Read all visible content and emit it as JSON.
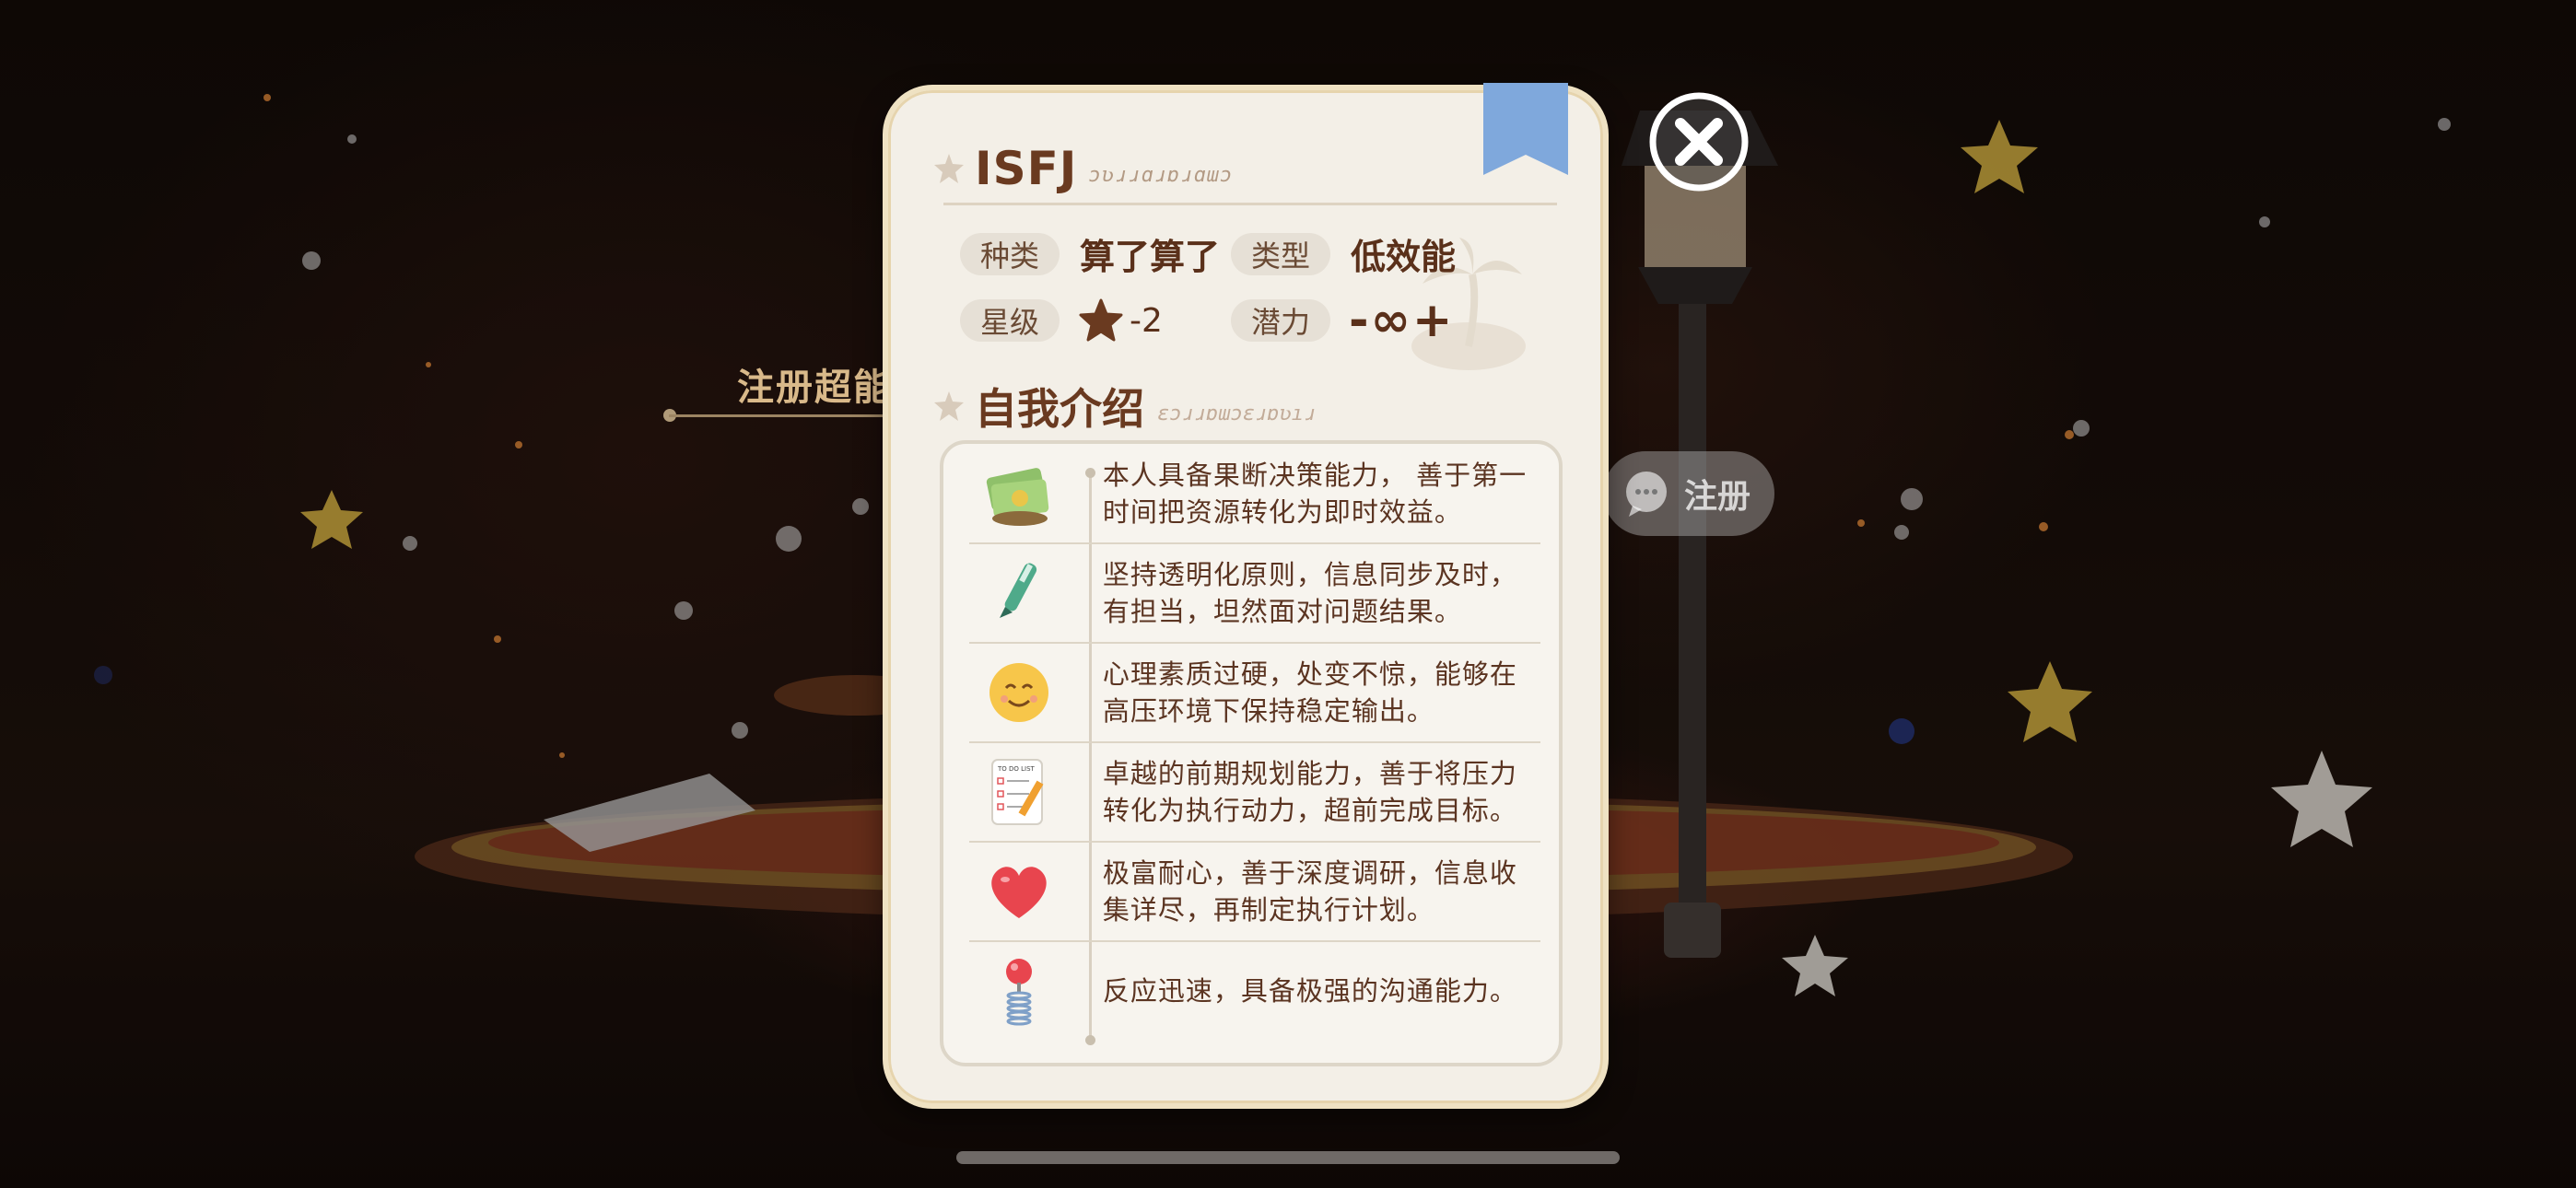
{
  "background": {
    "register_label": "注册超能",
    "register_button_label": "注册",
    "register_button_icon": "chat-bubble-icon"
  },
  "card": {
    "title": "ISFJ",
    "title_decoration": "ɔʋɹɹɑɹɒɹɑɯɔ",
    "attributes": {
      "kind_label": "种类",
      "kind_value": "算了算了",
      "type_label": "类型",
      "type_value": "低效能",
      "star_label": "星级",
      "star_value": "-2",
      "potential_label": "潜力",
      "potential_value": "-∞+"
    },
    "section_title": "自我介绍",
    "section_decoration": "ɛɔɹɹɒɯɔɛɹɒʋıɹ",
    "intro_items": [
      {
        "icon": "money-stack-icon",
        "text": "本人具备果断决策能力， 善于第一时间把资源转化为即时效益。"
      },
      {
        "icon": "pen-icon",
        "text": "坚持透明化原则，信息同步及时，有担当，坦然面对问题结果。"
      },
      {
        "icon": "smile-face-icon",
        "text": "心理素质过硬，处变不惊，能够在高压环境下保持稳定输出。"
      },
      {
        "icon": "todo-list-icon",
        "text": "卓越的前期规划能力，善于将压力转化为执行动力，超前完成目标。"
      },
      {
        "icon": "heart-icon",
        "text": "极富耐心，善于深度调研，信息收集详尽，再制定执行计划。"
      },
      {
        "icon": "spring-toy-icon",
        "text": "反应迅速，具备极强的沟通能力。"
      }
    ],
    "todo_icon_caption": "TO DO LIST"
  },
  "colors": {
    "card_bg": "#f3efe7",
    "bookmark": "#7fa8dc",
    "title_brown": "#6a3a20",
    "text_brown": "#5b3421"
  }
}
